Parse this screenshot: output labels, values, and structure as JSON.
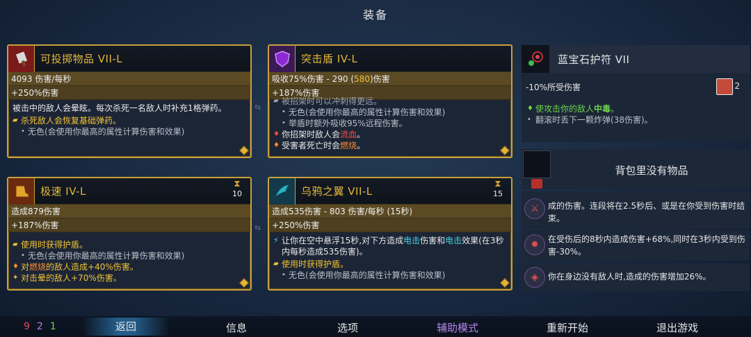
{
  "title": "装备",
  "cards": {
    "throw": {
      "name": "可投掷物品 VII-L",
      "stat1": "4093 伤害/每秒",
      "stat2": "+250%伤害",
      "desc": "被击中的敌人会晕眩。每次杀死一名敌人时补充1格弹药。",
      "line1": "杀死敌人会恢复基础弹药。",
      "line2": "无色(会使用你最高的属性计算伤害和效果)"
    },
    "shield": {
      "name": "突击盾 IV-L",
      "stat1_prefix": "吸收75%伤害 - 290 (",
      "stat1_hl": "580",
      "stat1_suffix": ")伤害",
      "stat2": "+187%伤害",
      "line0": "被招架时可以冲刺得更远。",
      "line1": "无色(会使用你最高的属性计算伤害和效果)",
      "line2": "举盾时额外吸收95%远程伤害。",
      "line3_prefix": "你招架时敌人会",
      "line3_hl": "流血",
      "line3_suffix": "。",
      "line4_prefix": "受害者死亡时会",
      "line4_hl": "燃烧",
      "line4_suffix": "。"
    },
    "speed": {
      "name": "极速 IV-L",
      "cooldown": "10",
      "stat1": "造成879伤害",
      "stat2": "+187%伤害",
      "line0": "使用时获得护盾。",
      "line1": "无色(会使用你最高的属性计算伤害和效果)",
      "line2_prefix": "对",
      "line2_hl": "燃烧",
      "line2_suffix": "的敌人造成+40%伤害。",
      "line3": "对击晕的敌人+70%伤害。"
    },
    "crow": {
      "name": "乌鸦之翼 VII-L",
      "cooldown": "15",
      "stat1": "造成535伤害 - 803 伤害/每秒 (15秒)",
      "stat2": "+250%伤害",
      "desc_prefix": "让你在空中悬浮15秒,对下方造成",
      "desc_hl1": "电击",
      "desc_mid": "伤害和",
      "desc_hl2": "电击",
      "desc_suffix": "效果(在3秒内每秒造成535伤害)。",
      "line1": "使用时获得护盾。",
      "line2": "无色(会使用你最高的属性计算伤害和效果)"
    }
  },
  "amulet": {
    "name": "蓝宝石护符 VII",
    "stat": "-10%所受伤害",
    "count": "2",
    "effect1_prefix": "使攻击你的敌人",
    "effect1_hl": "中毒",
    "effect1_suffix": "。",
    "effect2": "翻滚时丢下一颗炸弹(38伤害)。"
  },
  "backpack": {
    "text": "背包里没有物品"
  },
  "mutations": [
    {
      "text": "成的伤害。连段将在2.5秒后、或是在你受到伤害时结束。"
    },
    {
      "text": "在受伤后的8秒内造成伤害+68%,同时在3秒内受到伤害-30%。"
    },
    {
      "text": "你在身边没有敌人时,造成的伤害增加26%。"
    }
  ],
  "bottombar": {
    "cells": {
      "brutality": "9",
      "tactics": "2",
      "survival": "1"
    },
    "back": "返回",
    "info": "信息",
    "options": "选项",
    "assist": "辅助模式",
    "restart": "重新开始",
    "quit": "退出游戏"
  },
  "colors": {
    "accent_gold": "#c9a13a",
    "brutality": "#e0485a",
    "tactics": "#b07ee6",
    "survival": "#6ed34c",
    "assist_active": "#b487e8"
  }
}
